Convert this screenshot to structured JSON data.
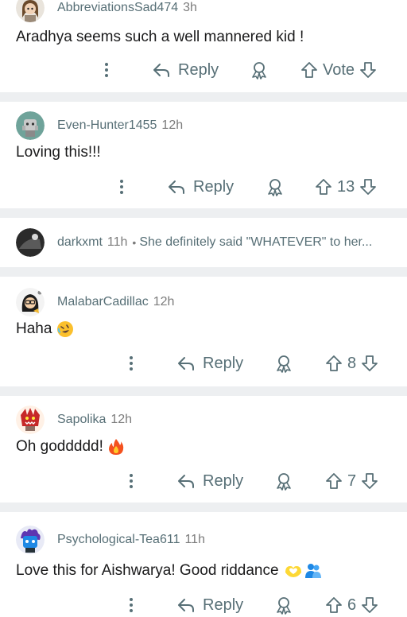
{
  "comments": [
    {
      "user": "AbbreviationsSad474",
      "time": "3h",
      "text": "Aradhya seems such a well mannered kid !",
      "score": "Vote",
      "reply_label": "Reply",
      "avatar": "snoo-avatar-brown-hair"
    },
    {
      "user": "Even-Hunter1455",
      "time": "12h",
      "text": "Loving this!!!",
      "score": "13",
      "reply_label": "Reply",
      "avatar": "snoo-avatar-gray-teal"
    },
    {
      "user": "darkxmt",
      "time": "11h",
      "snippet": "She definitely said \"WHATEVER\" to her...",
      "collapsed": true,
      "avatar": "photo-avatar-dark"
    },
    {
      "user": "MalabarCadillac",
      "time": "12h",
      "text": "Haha",
      "emoji": "rolling-on-floor-laughing",
      "score": "8",
      "reply_label": "Reply",
      "avatar": "snoo-avatar-black-hair"
    },
    {
      "user": "Sapolika",
      "time": "12h",
      "text": "Oh goddddd!",
      "emoji": "fire",
      "score": "7",
      "reply_label": "Reply",
      "avatar": "snoo-avatar-red-monster"
    },
    {
      "user": "Psychological-Tea611",
      "time": "11h",
      "text": "Love this for Aishwarya! Good riddance",
      "emoji": "heart-hands-and-people-hugging",
      "score": "6",
      "reply_label": "Reply",
      "avatar": "snoo-avatar-purple-flame"
    }
  ],
  "colors": {
    "meta_text": "#576f76",
    "body_text": "#1a1a1b",
    "separator": "#edeff1"
  }
}
